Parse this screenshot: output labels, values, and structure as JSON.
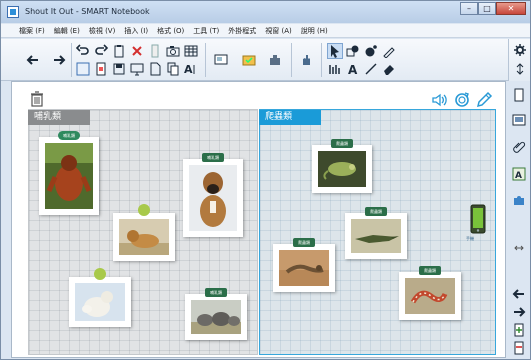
{
  "window": {
    "title": "Shout It Out - SMART Notebook"
  },
  "menu": [
    {
      "label": "檔案 (F)"
    },
    {
      "label": "編輯 (E)"
    },
    {
      "label": "檢視 (V)"
    },
    {
      "label": "插入 (I)"
    },
    {
      "label": "格式 (O)"
    },
    {
      "label": "工具 (T)"
    },
    {
      "label": "外掛程式"
    },
    {
      "label": "視窗 (A)"
    },
    {
      "label": "說明 (H)"
    }
  ],
  "activity": {
    "groups": [
      {
        "label": "哺乳類"
      },
      {
        "label": "爬蟲類"
      }
    ],
    "mammal_cards": [
      {
        "tag": "哺乳類",
        "animal": "orangutan"
      },
      {
        "tag": "哺乳類",
        "animal": "boxer-dog"
      },
      {
        "tag": "",
        "animal": "lion"
      },
      {
        "tag": "",
        "animal": "polar-bear"
      },
      {
        "tag": "哺乳類",
        "animal": "elephants"
      }
    ],
    "reptile_cards": [
      {
        "tag": "爬蟲類",
        "animal": "chameleon"
      },
      {
        "tag": "爬蟲類",
        "animal": "crocodile"
      },
      {
        "tag": "爬蟲類",
        "animal": "lizard"
      },
      {
        "tag": "爬蟲類",
        "animal": "snake"
      }
    ],
    "phone_label": "手機"
  },
  "colors": {
    "accent": "#1a9bd8",
    "mammal_header": "#8a8c8e",
    "tag_green": "#2f8a5f",
    "tag_lime": "#a8c94a"
  },
  "icons": {
    "trash": "trash-icon",
    "sound": "speaker-icon",
    "reset": "reset-icon",
    "edit": "pencil-icon"
  }
}
